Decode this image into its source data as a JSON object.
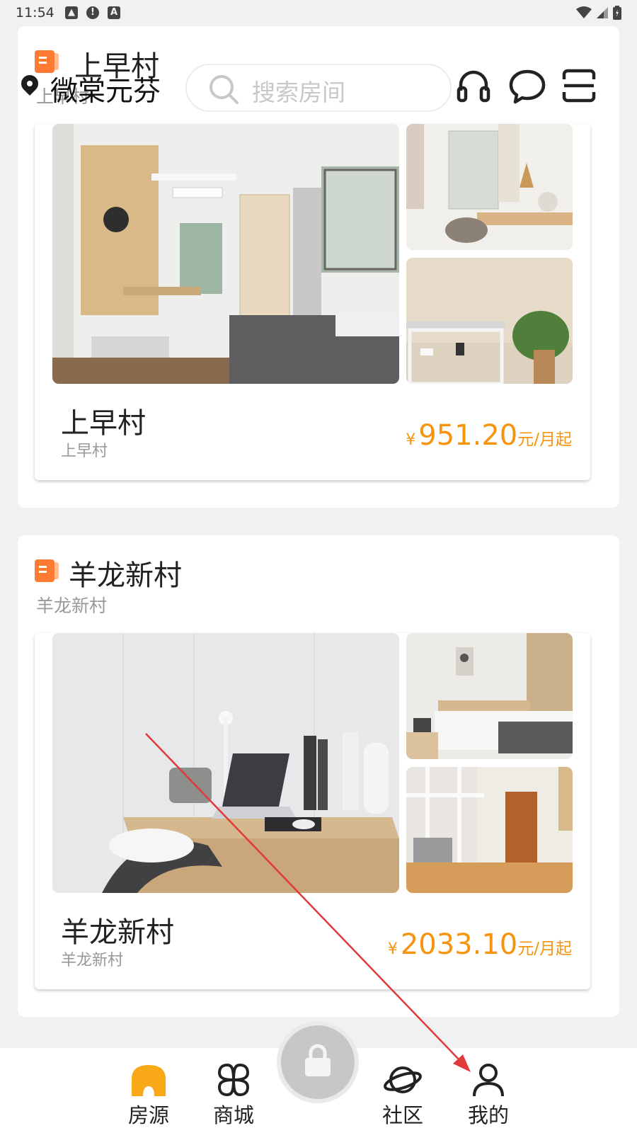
{
  "status_bar": {
    "time": "11:54"
  },
  "top_bar": {
    "location": "微棠元芬",
    "search_placeholder": "搜索房间"
  },
  "sections": [
    {
      "group_title": "上早村",
      "group_subtitle": "上早村",
      "card": {
        "name": "上早村",
        "subtitle": "上早村",
        "price": {
          "currency": "¥",
          "amount": "951.20",
          "unit": "元/月起"
        }
      }
    },
    {
      "group_title": "羊龙新村",
      "group_subtitle": "羊龙新村",
      "card": {
        "name": "羊龙新村",
        "subtitle": "羊龙新村",
        "price": {
          "currency": "¥",
          "amount": "2033.10",
          "unit": "元/月起"
        }
      }
    }
  ],
  "tab_bar": {
    "items": [
      {
        "label": "房源",
        "icon": "house-icon",
        "active": true
      },
      {
        "label": "商城",
        "icon": "four-petal-icon",
        "active": false
      },
      {
        "label": "社区",
        "icon": "planet-icon",
        "active": false
      },
      {
        "label": "我的",
        "icon": "person-icon",
        "active": false
      }
    ],
    "center_icon": "lock-icon"
  },
  "colors": {
    "accent": "#f7930d",
    "group_icon": "#ff7a33",
    "annotation_arrow": "#e03a3a"
  }
}
